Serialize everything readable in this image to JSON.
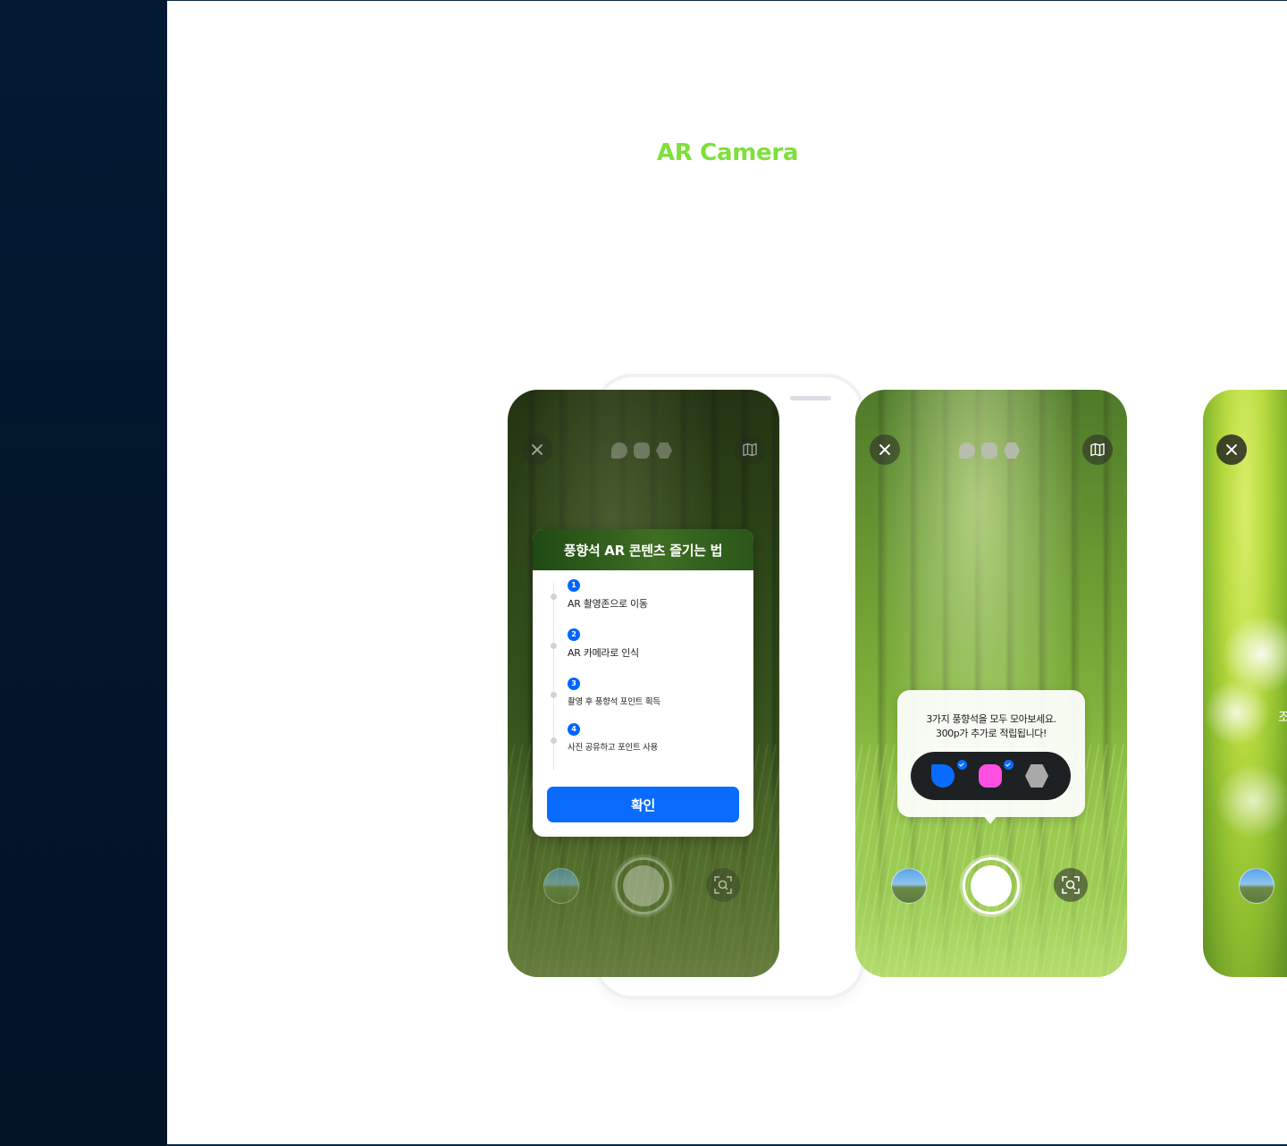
{
  "page": {
    "title": "AR Camera",
    "accent_color": "#7ee03a",
    "sidebar_color": "#021a33"
  },
  "screen1": {
    "close_icon": "close-icon",
    "map_icon": "map-icon",
    "dialog": {
      "title": "풍향석 AR 콘텐츠 즐기는 법",
      "steps": [
        {
          "num": "1",
          "text": "AR 촬영존으로 이동"
        },
        {
          "num": "2",
          "text": "AR 카메라로 인식"
        },
        {
          "num": "3",
          "text": "촬영 후 풍향석 포인트 획득"
        },
        {
          "num": "4",
          "text": "사진 공유하고 포인트 사용"
        }
      ],
      "confirm_label": "확인"
    }
  },
  "screen2": {
    "tooltip_line1": "3가지 풍향석을 모두 모아보세요.",
    "tooltip_line2": "300p가 추가로 적립됩니다!",
    "stones": [
      {
        "name": "blue-stone",
        "color": "#0a6cff",
        "collected": true
      },
      {
        "name": "pink-stone",
        "color": "#ff4fe0",
        "collected": true
      },
      {
        "name": "gray-stone",
        "color": "#a9a9a9",
        "collected": false
      }
    ]
  },
  "screen3": {
    "partial_text": "조"
  },
  "colors": {
    "primary_button": "#0a6cff"
  }
}
